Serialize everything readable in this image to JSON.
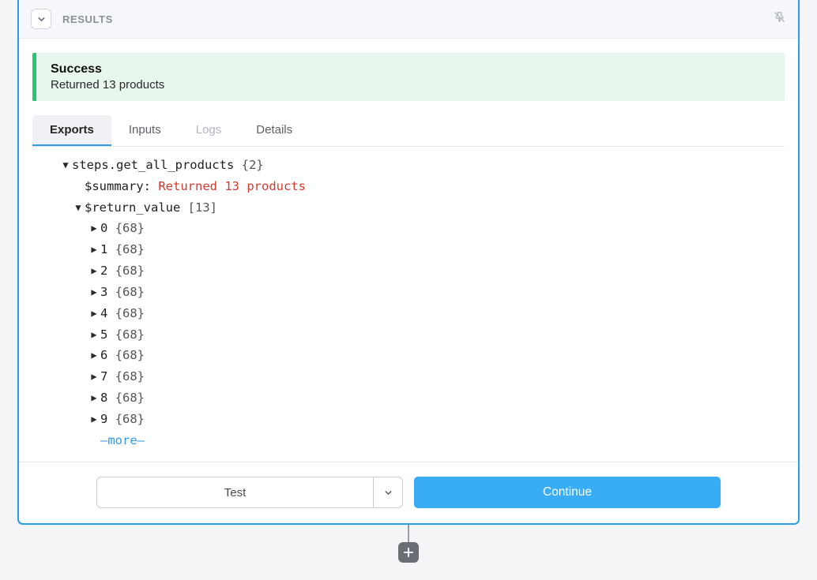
{
  "header": {
    "results_label": "RESULTS"
  },
  "banner": {
    "title": "Success",
    "message": "Returned 13 products"
  },
  "tabs": {
    "exports": "Exports",
    "inputs": "Inputs",
    "logs": "Logs",
    "details": "Details"
  },
  "tree": {
    "root_key": "steps.get_all_products",
    "root_meta": "{2}",
    "summary_key": "$summary:",
    "summary_val": "Returned 13 products",
    "return_key": "$return_value",
    "return_meta": "[13]",
    "items": [
      {
        "idx": "0",
        "meta": "{68}"
      },
      {
        "idx": "1",
        "meta": "{68}"
      },
      {
        "idx": "2",
        "meta": "{68}"
      },
      {
        "idx": "3",
        "meta": "{68}"
      },
      {
        "idx": "4",
        "meta": "{68}"
      },
      {
        "idx": "5",
        "meta": "{68}"
      },
      {
        "idx": "6",
        "meta": "{68}"
      },
      {
        "idx": "7",
        "meta": "{68}"
      },
      {
        "idx": "8",
        "meta": "{68}"
      },
      {
        "idx": "9",
        "meta": "{68}"
      }
    ],
    "more": "—more—"
  },
  "footer": {
    "test_label": "Test",
    "continue_label": "Continue"
  }
}
